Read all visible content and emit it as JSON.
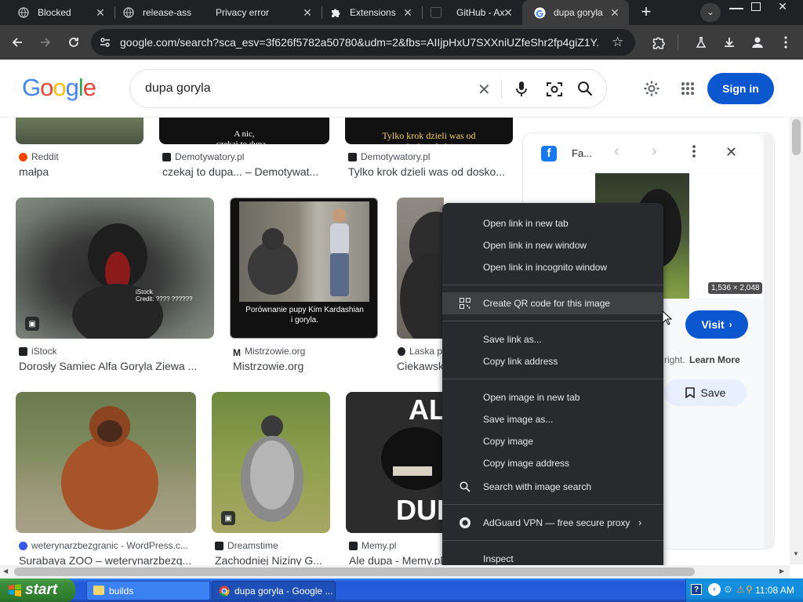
{
  "browser": {
    "tabs": [
      {
        "title": "Blocked",
        "icon": "globe-icon"
      },
      {
        "title": "release-asse",
        "icon": "globe-icon"
      },
      {
        "title": "Privacy error",
        "icon": "none"
      },
      {
        "title": "Extensions",
        "icon": "puzzle-icon"
      },
      {
        "title": "GitHub - Axt",
        "icon": "github-icon"
      },
      {
        "title": "dupa goryla",
        "icon": "google-icon",
        "active": true
      }
    ],
    "url": "google.com/search?sca_esv=3f626f5782a50780&udm=2&fbs=AIIjpHxU7SXXniUZfeShr2fp4giZ1Y..."
  },
  "google": {
    "logo": "Google",
    "query": "dupa goryla",
    "sign_in": "Sign in"
  },
  "results": {
    "row0": [
      {
        "source": "Reddit",
        "caption": "małpa",
        "overlay": ""
      },
      {
        "source": "Demotywatory.pl",
        "caption": "czekaj to dupa... – Demotywat...",
        "overlay": "A nic,\nczekaj to dupa..."
      },
      {
        "source": "Demotywatory.pl",
        "caption": "Tylko krok dzieli was od dosko...",
        "overlay": "Tylko krok dzieli was od\ndoskonałości"
      }
    ],
    "row1": [
      {
        "source": "iStock",
        "caption": "Dorosły Samiec Alfa Goryla Ziewa ...",
        "watermark": "iStock\nCredit: ???? ??????"
      },
      {
        "source": "Mistrzowie.org",
        "caption": "Mistrzowie.org",
        "overlay": "Porównanie pupy Kim Kardashian\ni goryla."
      },
      {
        "source": "Laska p",
        "caption": "Ciekawsk"
      }
    ],
    "row2": [
      {
        "source": "weterynarzbezgranic - WordPress.c...",
        "caption": "Surabaya ZOO – weterynarzbezg..."
      },
      {
        "source": "Dreamstime",
        "caption": "Zachodniej Niziny G..."
      },
      {
        "source": "Memy.pl",
        "caption": "Ale dupa - Memy.pl",
        "overlay_top": "ALE",
        "overlay_bottom": "DUPA"
      }
    ]
  },
  "panel": {
    "source": "Fa...",
    "dims": "1,536 × 2,048",
    "visit": "Visit",
    "copyright_prefix": "right.",
    "learn_more": "Learn More",
    "save": "Save"
  },
  "context_menu": {
    "groups": [
      [
        "Open link in new tab",
        "Open link in new window",
        "Open link in incognito window"
      ],
      [
        "Create QR code for this image"
      ],
      [
        "Save link as...",
        "Copy link address"
      ],
      [
        "Open image in new tab",
        "Save image as...",
        "Copy image",
        "Copy image address",
        "Search with image search"
      ],
      [
        "AdGuard VPN — free  secure proxy"
      ],
      [
        "Inspect"
      ]
    ]
  },
  "taskbar": {
    "start": "start",
    "buttons": [
      "builds",
      "dupa goryla - Google ..."
    ],
    "clock": "11:08 AM"
  }
}
